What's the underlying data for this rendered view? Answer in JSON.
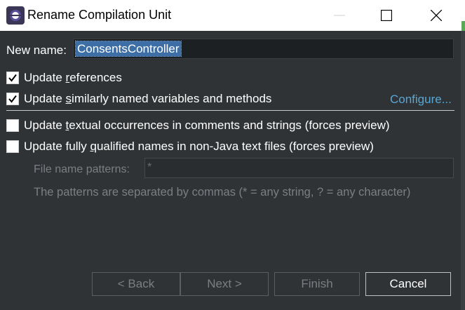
{
  "window": {
    "title": "Rename Compilation Unit"
  },
  "form": {
    "new_name_label": "New name:",
    "new_name_value": "ConsentsController",
    "options": [
      {
        "pre": "Update ",
        "accel": "r",
        "post": "eferences",
        "checked": true
      },
      {
        "pre": "Update ",
        "accel": "s",
        "post": "imilarly named variables and methods",
        "checked": true
      },
      {
        "pre": "Update ",
        "accel": "t",
        "post": "extual occurrences in comments and strings (forces preview)",
        "checked": false
      },
      {
        "pre": "Update fully ",
        "accel": "q",
        "post": "ualified names in non-Java text files (forces preview)",
        "checked": false
      }
    ],
    "configure_link": "Configure...",
    "file_patterns_label": "File name patterns:",
    "file_patterns_value": "*",
    "patterns_hint": "The patterns are separated by commas (* = any string, ? = any character)"
  },
  "buttons": {
    "back": "< Back",
    "next": "Next >",
    "finish": "Finish",
    "cancel": "Cancel",
    "back_enabled": false,
    "next_enabled": false,
    "finish_enabled": false,
    "cancel_enabled": true
  },
  "colors": {
    "background": "#2f3336",
    "link": "#57a7d6",
    "selection": "#3d6fa6",
    "disabled_text": "#7b7f82"
  }
}
